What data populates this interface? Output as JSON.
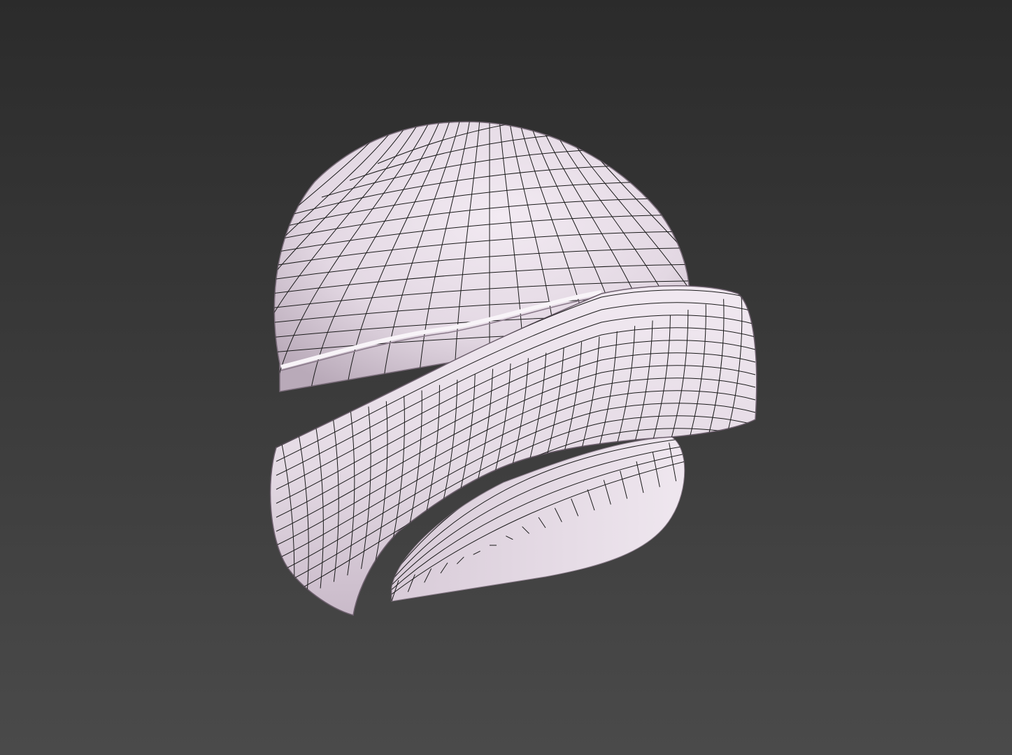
{
  "viewport": {
    "background_top": "#2b2b2b",
    "background_bottom": "#4a4a4a"
  },
  "model": {
    "name": "beanie-hat",
    "shading": "smooth-with-wireframe",
    "surface_color": "#ece4ec",
    "surface_shadow": "#a898a8",
    "wire_color": "#1a1a1a"
  }
}
